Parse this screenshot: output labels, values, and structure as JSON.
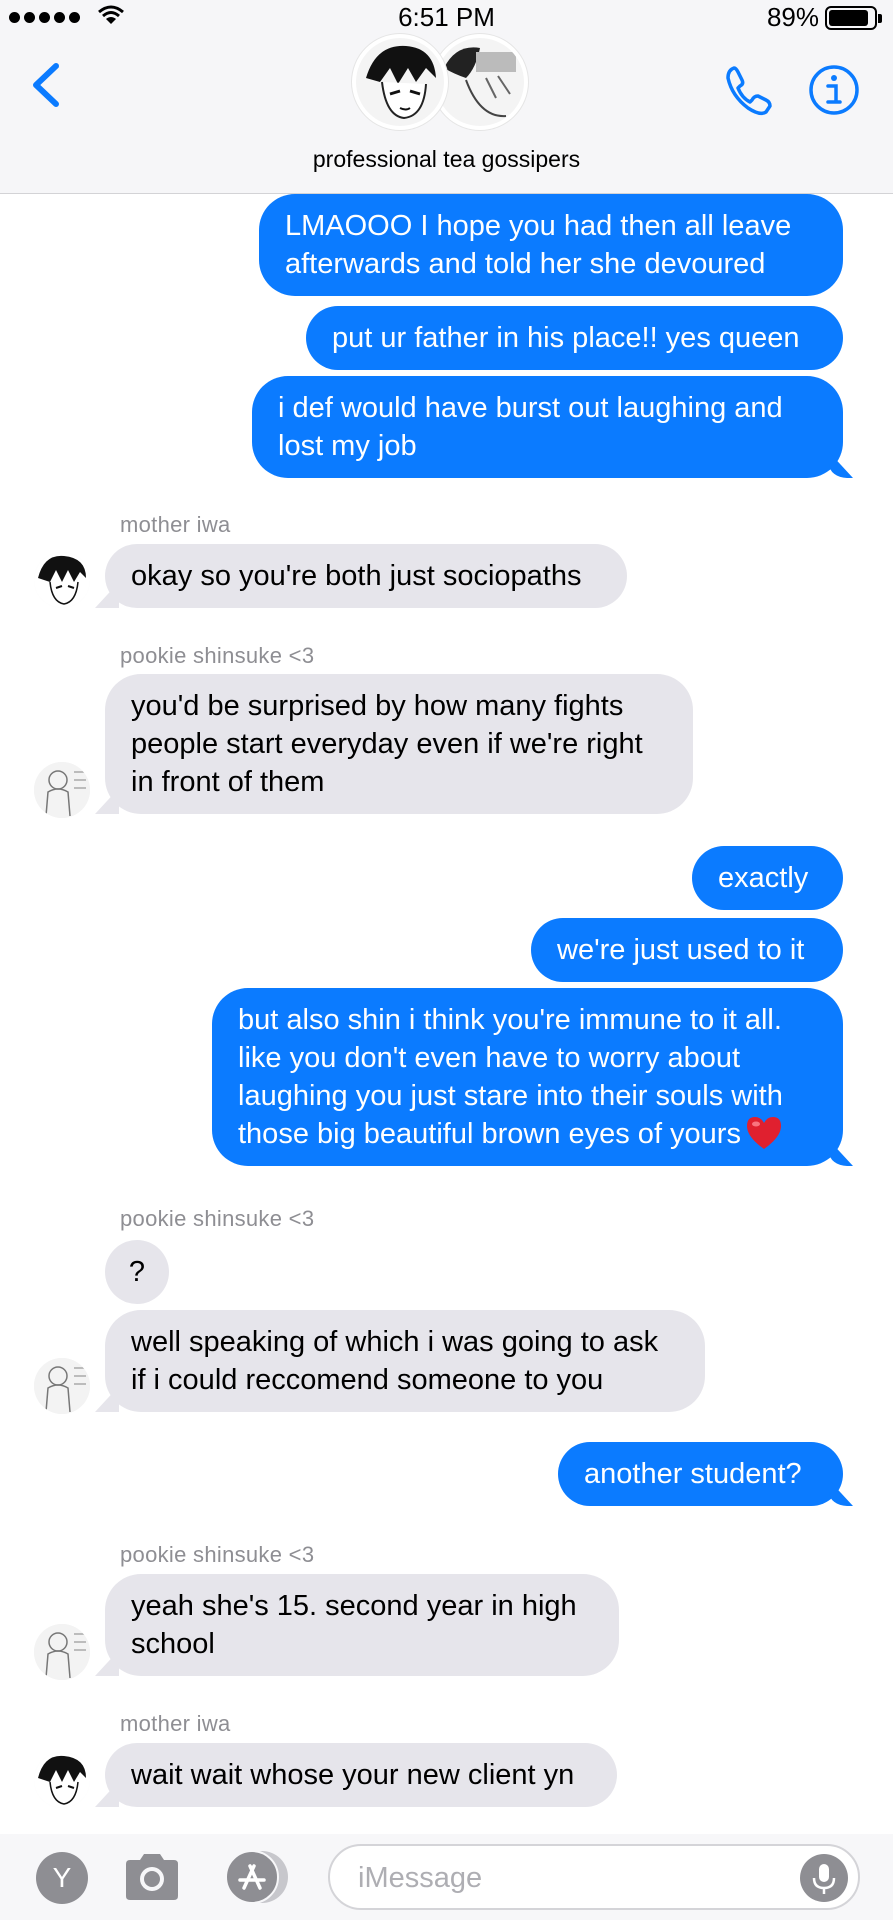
{
  "status": {
    "time": "6:51 PM",
    "battery": "89%"
  },
  "header": {
    "group_name": "professional tea gossipers"
  },
  "messages": [
    {
      "side": "out",
      "lines": [
        "LMAOOO I hope you had then all leave",
        "afterwards and told her she devoured"
      ]
    },
    {
      "side": "out",
      "lines": [
        "put ur father in his place!! yes queen"
      ]
    },
    {
      "side": "out",
      "lines": [
        "i def would have burst out laughing and",
        "lost my job"
      ]
    },
    {
      "side": "in",
      "sender": "mother iwa",
      "lines": [
        "okay so you're both just sociopaths"
      ]
    },
    {
      "side": "in",
      "sender": "pookie shinsuke <3",
      "lines": [
        "you'd be surprised by how many fights",
        "people start everyday even if we're right",
        "in front of them"
      ]
    },
    {
      "side": "out",
      "lines": [
        "exactly"
      ]
    },
    {
      "side": "out",
      "lines": [
        "we're just used to it"
      ]
    },
    {
      "side": "out",
      "lines": [
        "but also shin i think you're immune to it all.",
        "like you don't even have to worry about",
        "laughing you just stare into their souls with",
        "those big beautiful brown eyes of yours"
      ],
      "emoji": "red-heart"
    },
    {
      "side": "in",
      "sender": "pookie shinsuke <3",
      "lines": [
        "?"
      ]
    },
    {
      "side": "in",
      "lines": [
        "well speaking of which i was going to ask",
        "if i could reccomend someone to you"
      ]
    },
    {
      "side": "out",
      "lines": [
        "another student?"
      ]
    },
    {
      "side": "in",
      "sender": "pookie shinsuke <3",
      "lines": [
        "yeah she's 15. second year in high",
        "school"
      ]
    },
    {
      "side": "in",
      "sender": "mother iwa",
      "lines": [
        "wait wait whose your new client yn"
      ]
    }
  ],
  "input_bar": {
    "left_icon_letter": "Y",
    "placeholder": "iMessage"
  },
  "colors": {
    "outgoing_bubble": "#0b7bff",
    "incoming_bubble": "#e6e5eb",
    "accent": "#0b7bff"
  }
}
